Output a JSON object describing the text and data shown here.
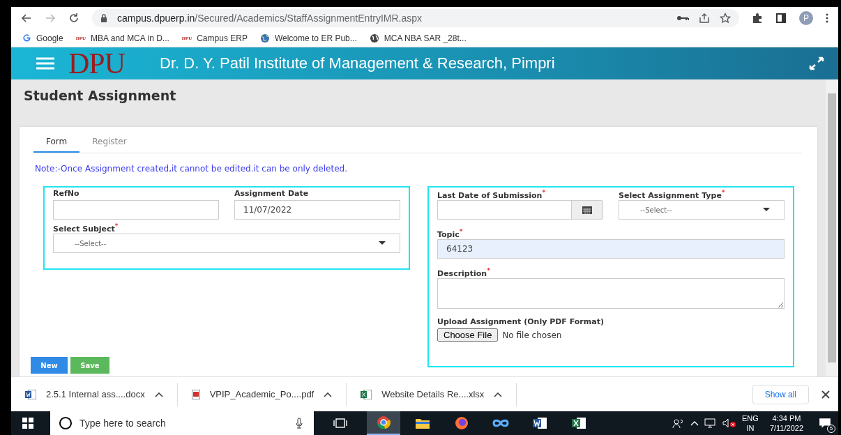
{
  "browser": {
    "url_host": "campus.dpuerp.in",
    "url_path": "/Secured/Academics/StaffAssignmentEntryIMR.aspx",
    "profile": "P",
    "bookmarks": [
      {
        "label": "Google",
        "kind": "google"
      },
      {
        "label": "MBA and MCA in D...",
        "kind": "dpu",
        "badge": "DPU"
      },
      {
        "label": "Campus ERP",
        "kind": "dpu",
        "badge": "DPU"
      },
      {
        "label": "Welcome to ER Pub...",
        "kind": "globe"
      },
      {
        "label": "MCA NBA SAR _28t...",
        "kind": "circle"
      }
    ]
  },
  "header": {
    "logo": "DPU",
    "title": "Dr. D. Y. Patil Institute of Management & Research, Pimpri"
  },
  "page_title": "Student Assignment",
  "tabs": [
    {
      "label": "Form",
      "selected": true
    },
    {
      "label": "Register",
      "selected": false
    }
  ],
  "note": "Note:-Once Assignment created,it cannot be edited.it can be only deleted.",
  "left_panel": [
    [
      {
        "kind": "text",
        "label": "RefNo"
      },
      {
        "kind": "text",
        "label": "Assignment Date",
        "value": "11/07/2022"
      }
    ],
    [
      {
        "kind": "select",
        "label": "Select Subject",
        "required_mark": "*",
        "placeholder": "--Select--"
      }
    ]
  ],
  "right_panel": [
    [
      {
        "kind": "date",
        "label": "Last Date of Submission",
        "required_mark": "*"
      },
      {
        "kind": "select",
        "label": "Select Assignment Type",
        "required_mark": "*",
        "placeholder": "--Select--"
      }
    ],
    [
      {
        "kind": "text",
        "label": "Topic",
        "required_mark": "*",
        "value": "64123",
        "autofilled": true
      }
    ],
    [
      {
        "kind": "textarea",
        "label": "Description",
        "required_mark": "*"
      }
    ],
    [
      {
        "kind": "file",
        "label": "Upload Assignment (Only PDF Format)",
        "button": "Choose File",
        "status": "No file chosen"
      }
    ]
  ],
  "buttons": [
    {
      "label": "New",
      "kind": "primary"
    },
    {
      "label": "Save",
      "kind": "success"
    }
  ],
  "downloads": [
    {
      "name": "2.5.1 Internal ass....docx",
      "kind": "word"
    },
    {
      "name": "VPIP_Academic_Po....pdf",
      "kind": "pdf"
    },
    {
      "name": "Website Details Re....xlsx",
      "kind": "excel"
    }
  ],
  "show_all": "Show all",
  "taskbar": {
    "search_placeholder": "Type here to search",
    "apps": [
      {
        "kind": "chrome",
        "active": true
      },
      {
        "kind": "folder",
        "active": false
      },
      {
        "kind": "firefox",
        "active": false
      },
      {
        "kind": "infinity",
        "active": false
      },
      {
        "kind": "word",
        "active": false
      },
      {
        "kind": "excel",
        "active": false
      }
    ],
    "language": "ENG",
    "region": "IN",
    "time": "4:34 PM",
    "date": "7/11/2022",
    "notifications": "5"
  }
}
